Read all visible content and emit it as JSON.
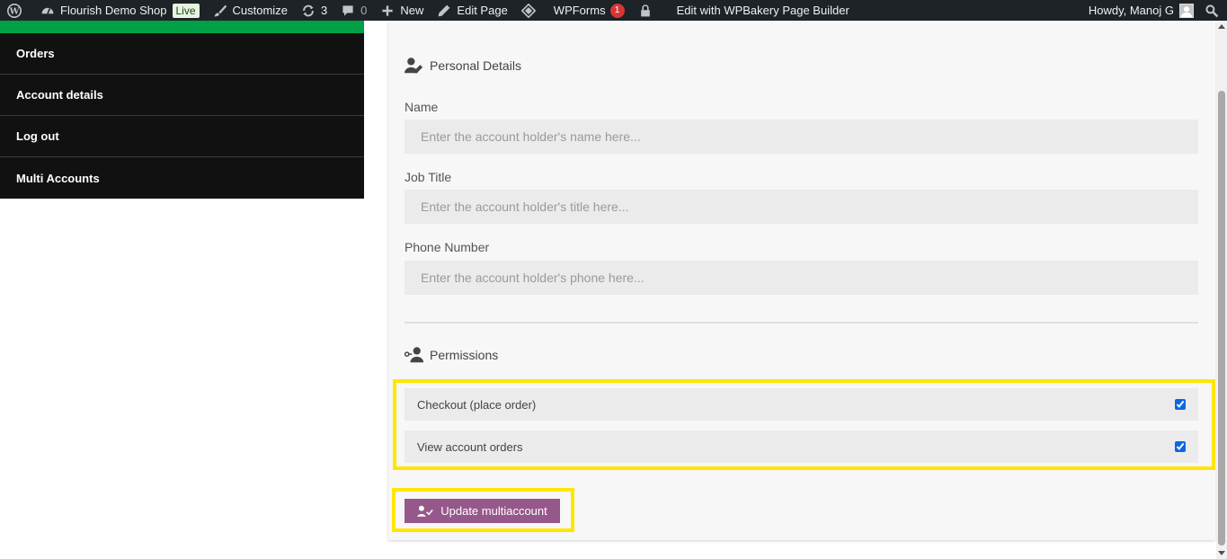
{
  "adminbar": {
    "site_name": "Flourish Demo Shop",
    "live_badge": "Live",
    "customize": "Customize",
    "updates_count": "3",
    "comments_count": "0",
    "new": "New",
    "edit_page": "Edit Page",
    "wpforms": "WPForms",
    "wpforms_badge": "1",
    "wpbakery": "Edit with WPBakery Page Builder",
    "howdy": "Howdy, Manoj G"
  },
  "nav": {
    "items": [
      {
        "label": "Orders"
      },
      {
        "label": "Account details"
      },
      {
        "label": "Log out"
      },
      {
        "label": "Multi Accounts"
      }
    ]
  },
  "form": {
    "personal_heading": "Personal Details",
    "name_label": "Name",
    "name_placeholder": "Enter the account holder's name here...",
    "job_label": "Job Title",
    "job_placeholder": "Enter the account holder's title here...",
    "phone_label": "Phone Number",
    "phone_placeholder": "Enter the account holder's phone here...",
    "permissions_heading": "Permissions",
    "permissions": [
      {
        "label": "Checkout (place order)",
        "checked": true
      },
      {
        "label": "View account orders",
        "checked": true
      }
    ],
    "update_button": "Update multiaccount"
  },
  "colors": {
    "adminbar": "#1d2327",
    "accent_green": "#00a046",
    "nav_bg": "#111111",
    "button": "#96588a",
    "highlight": "#ffe600"
  }
}
